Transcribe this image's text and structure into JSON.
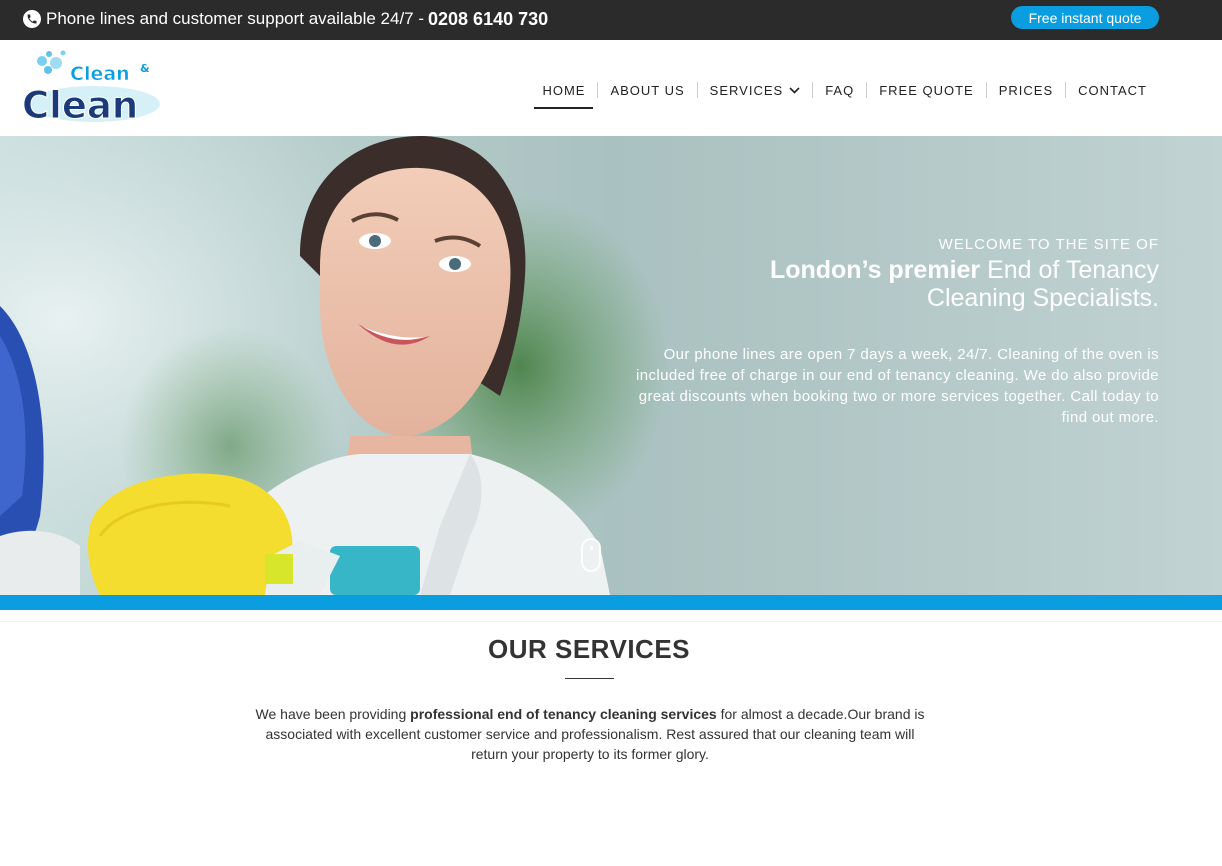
{
  "topbar": {
    "support_text": "Phone lines and customer support available 24/7 -",
    "phone_number": "0208 6140 730",
    "quote_button": "Free instant quote",
    "phone_icon": "phone-icon"
  },
  "logo": {
    "line1": "Clean",
    "amp": "&",
    "line2": "Clean"
  },
  "nav": {
    "items": [
      {
        "label": "HOME",
        "active": true
      },
      {
        "label": "ABOUT US"
      },
      {
        "label": "SERVICES",
        "has_dropdown": true
      },
      {
        "label": "FAQ"
      },
      {
        "label": "FREE QUOTE"
      },
      {
        "label": "PRICES"
      },
      {
        "label": "CONTACT"
      }
    ]
  },
  "hero": {
    "eyebrow": "WELCOME TO THE SITE OF",
    "title_bold": "London’s premier",
    "title_rest": " End of Tenancy",
    "title_line2": "Cleaning Specialists.",
    "description": "Our phone lines are open 7 days a week, 24/7. Cleaning of the oven is included free of charge in our end of tenancy cleaning. We do also provide great discounts when booking two or more services together. Call today to find out more."
  },
  "services": {
    "title_bold": "OUR",
    "title_rest": " SERVICES",
    "desc_prefix": "We have been providing ",
    "desc_bold": "professional end of tenancy cleaning services",
    "desc_suffix": " for almost a decade.Our brand is associated with excellent customer service and professionalism. Rest assured that our cleaning team will return your property to its former glory."
  },
  "colors": {
    "topbar_bg": "#2b2b2b",
    "accent_blue": "#0a9ee0",
    "logo_navy": "#1b3a7a"
  }
}
